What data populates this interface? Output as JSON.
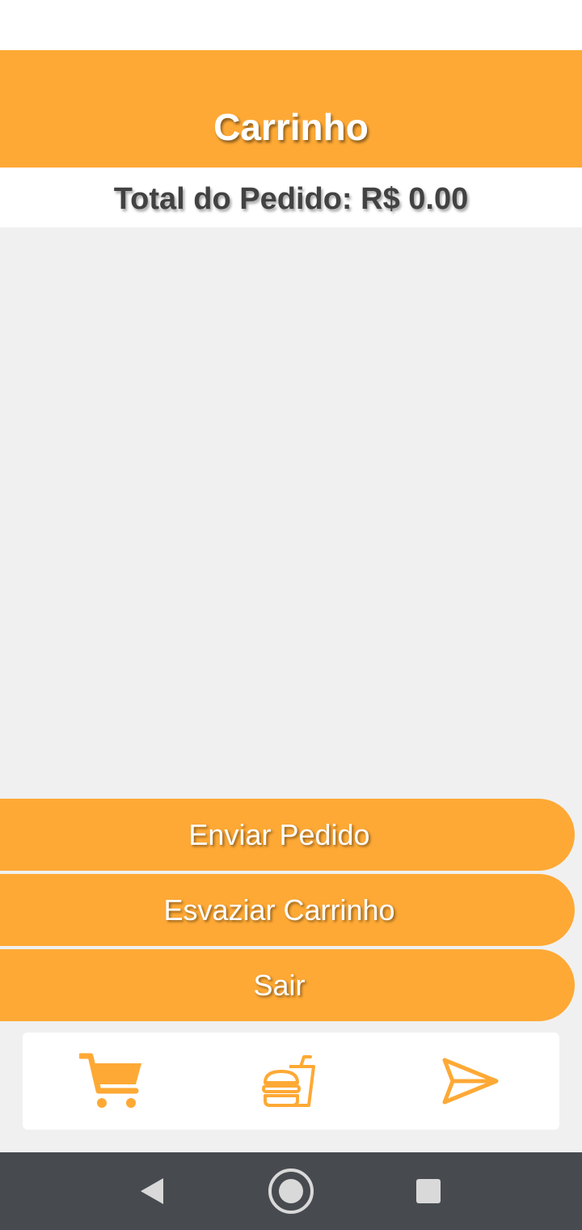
{
  "header": {
    "title": "Carrinho"
  },
  "order": {
    "total_label": "Total do Pedido: R$ 0.00"
  },
  "actions": {
    "send_label": "Enviar Pedido",
    "empty_label": "Esvaziar Carrinho",
    "exit_label": "Sair"
  },
  "bottom_nav": {
    "items": [
      {
        "icon": "cart-icon"
      },
      {
        "icon": "burger-drink-icon"
      },
      {
        "icon": "send-icon"
      }
    ]
  },
  "system_nav": {
    "items": [
      {
        "icon": "back-icon"
      },
      {
        "icon": "home-icon"
      },
      {
        "icon": "recent-apps-icon"
      }
    ]
  },
  "colors": {
    "accent": "#fea935",
    "background": "#f0f0f0",
    "text_dark": "#424242",
    "system_nav": "#474b50"
  }
}
